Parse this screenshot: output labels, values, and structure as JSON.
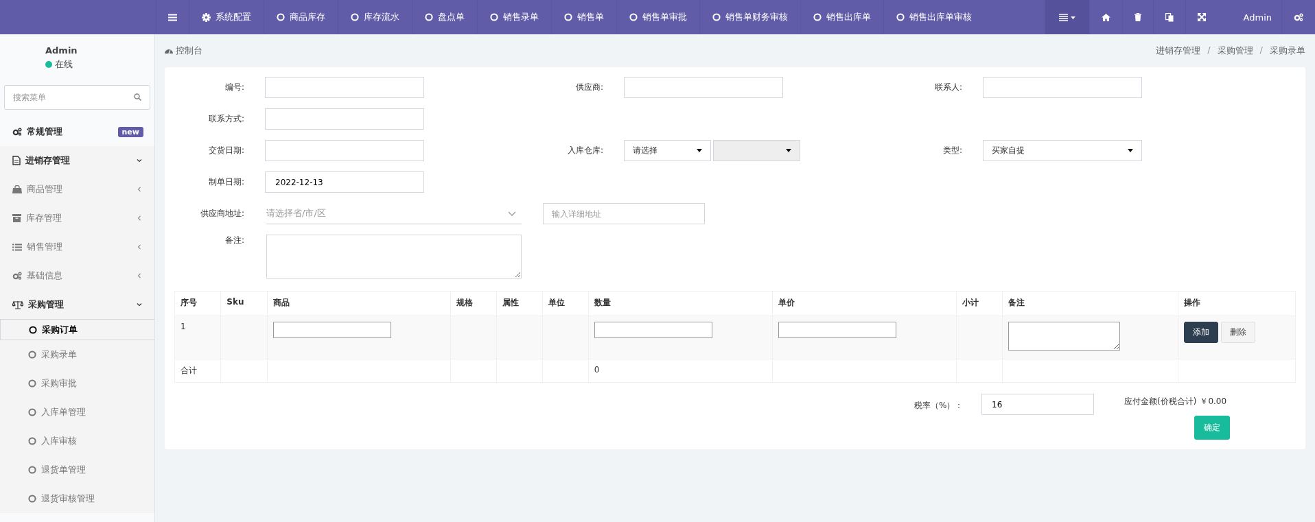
{
  "topbar": {
    "items": [
      {
        "label": "系统配置"
      },
      {
        "label": "商品库存"
      },
      {
        "label": "库存流水"
      },
      {
        "label": "盘点单"
      },
      {
        "label": "销售录单"
      },
      {
        "label": "销售单"
      },
      {
        "label": "销售单审批"
      },
      {
        "label": "销售单财务审核"
      },
      {
        "label": "销售出库单"
      },
      {
        "label": "销售出库单审核"
      }
    ],
    "user": "Admin"
  },
  "sidebar": {
    "user": {
      "name": "Admin",
      "status": "在线"
    },
    "search": {
      "placeholder": "搜索菜单"
    },
    "items": [
      {
        "label": "常规管理",
        "badge": "new"
      },
      {
        "label": "进销存管理",
        "expanded": true,
        "children": [
          {
            "label": "商品管理",
            "expanded": false
          },
          {
            "label": "库存管理",
            "expanded": false
          },
          {
            "label": "销售管理",
            "expanded": false
          },
          {
            "label": "基础信息",
            "expanded": false
          },
          {
            "label": "采购管理",
            "expanded": true,
            "children": [
              {
                "label": "采购订单",
                "selected": true
              },
              {
                "label": "采购录单",
                "selected": false
              },
              {
                "label": "采购审批",
                "selected": false
              },
              {
                "label": "入库单管理",
                "selected": false
              },
              {
                "label": "入库审核",
                "selected": false
              },
              {
                "label": "退货单管理",
                "selected": false
              },
              {
                "label": "退货审核管理",
                "selected": false
              }
            ]
          }
        ]
      }
    ]
  },
  "header": {
    "title": "控制台",
    "breadcrumb": [
      "进销存管理",
      "采购管理",
      "采购录单"
    ],
    "breadcrumb_separator": "/"
  },
  "form": {
    "rows": [
      [
        {
          "label": "编号:",
          "controls": [
            {
              "kind": "text"
            }
          ]
        },
        {
          "label": "供应商:",
          "controls": [
            {
              "kind": "text"
            }
          ]
        },
        {
          "label": "联系人:",
          "controls": [
            {
              "kind": "text"
            }
          ]
        }
      ],
      [
        {
          "label": "联系方式:",
          "controls": [
            {
              "kind": "text"
            }
          ]
        }
      ],
      [
        {
          "label": "交货日期:",
          "controls": [
            {
              "kind": "text"
            }
          ]
        },
        {
          "label": "入库仓库:",
          "controls": [
            {
              "kind": "select",
              "value": "请选择",
              "disabled": false
            },
            {
              "kind": "select",
              "disabled": true
            }
          ]
        },
        {
          "label": "类型:",
          "controls": [
            {
              "kind": "select",
              "value": "买家自提",
              "disabled": false
            }
          ]
        }
      ],
      [
        {
          "label": "制单日期:",
          "controls": [
            {
              "kind": "text",
              "value": "2022-12-13"
            }
          ]
        }
      ]
    ],
    "address": {
      "label": "供应商地址:",
      "region_placeholder": "请选择省/市/区",
      "detail_placeholder": "输入详细地址"
    },
    "remark": {
      "label": "备注:"
    }
  },
  "table": {
    "columns": [
      "序号",
      "Sku",
      "商品",
      "规格",
      "属性",
      "单位",
      "数量",
      "单价",
      "小计",
      "备注",
      "操作"
    ],
    "rows": [
      [
        {
          "kind": "text",
          "text": "1"
        },
        {
          "kind": "empty"
        },
        {
          "kind": "input"
        },
        {
          "kind": "empty"
        },
        {
          "kind": "empty"
        },
        {
          "kind": "empty"
        },
        {
          "kind": "input"
        },
        {
          "kind": "input"
        },
        {
          "kind": "empty"
        },
        {
          "kind": "textarea"
        },
        {
          "kind": "actions",
          "buttons": [
            {
              "label": "添加",
              "kind": "primary"
            },
            {
              "label": "删除",
              "kind": "default"
            }
          ]
        }
      ],
      [
        {
          "kind": "text",
          "text": "合计"
        },
        {
          "kind": "empty"
        },
        {
          "kind": "empty"
        },
        {
          "kind": "empty"
        },
        {
          "kind": "empty"
        },
        {
          "kind": "empty"
        },
        {
          "kind": "text",
          "text": "0"
        },
        {
          "kind": "empty"
        },
        {
          "kind": "empty"
        },
        {
          "kind": "empty"
        },
        {
          "kind": "empty"
        }
      ]
    ]
  },
  "footer": {
    "tax_label": "税率（%）：",
    "tax_value": "16",
    "amount_label": "应付金额(价税合计)",
    "amount": "￥0.00",
    "confirm": "确定"
  }
}
